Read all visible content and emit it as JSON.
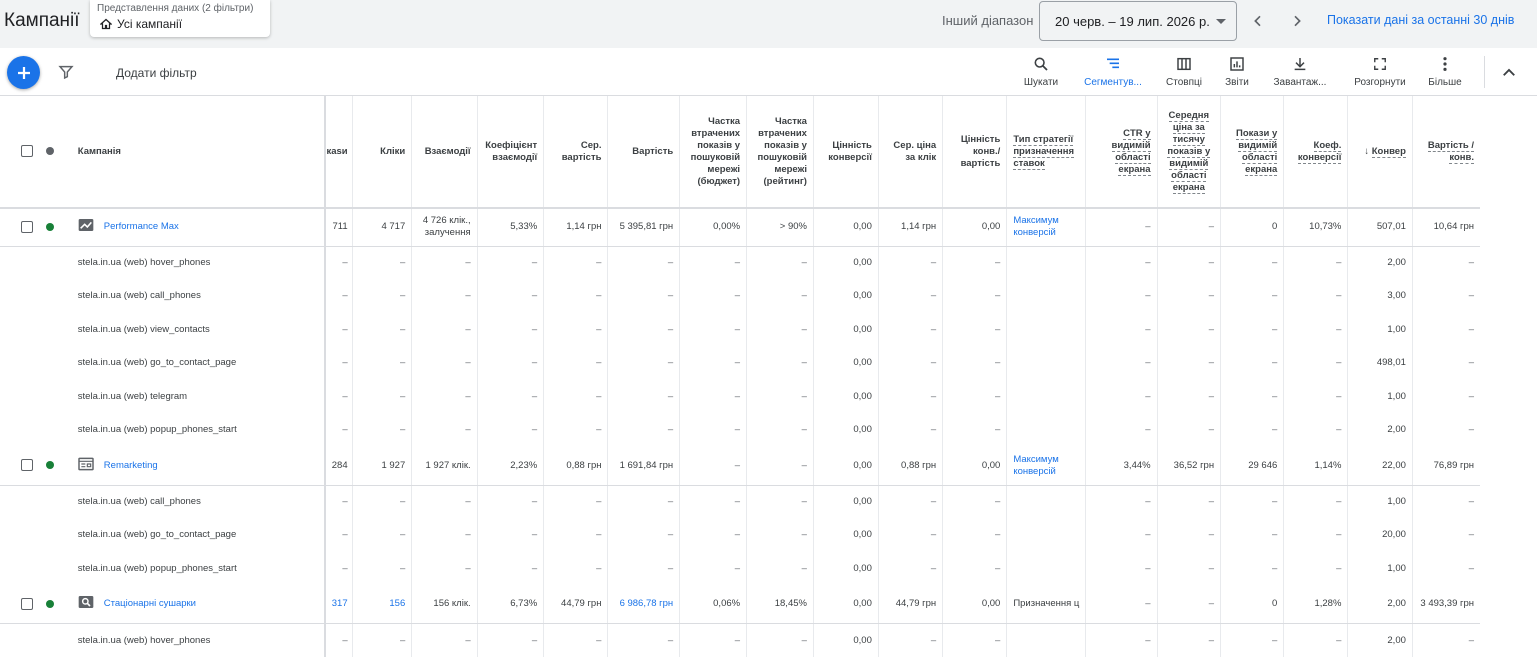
{
  "header": {
    "title": "Кампанії",
    "view_caption": "Представлення даних (2 фільтри)",
    "view_value": "Усі кампанії",
    "range_label": "Інший діапазон",
    "date_range": "20 черв. – 19 лип. 2026 р.",
    "compare_link": "Показати дані за останні 30 днів"
  },
  "toolbar": {
    "add_filter": "Додати фільтр",
    "search": "Шукати",
    "segment": "Сегментув...",
    "columns": "Стовпці",
    "reports": "Звіти",
    "download": "Завантаж...",
    "expand": "Розгорнути",
    "more": "Більше"
  },
  "colors": {
    "accent": "#1a73e8",
    "enabled_dot": "#188038",
    "header_bg": "#f1f3f4"
  },
  "table": {
    "headers": {
      "campaign": "Кампанія",
      "impressions": "каsи",
      "clicks": "Кліки",
      "interactions": "Взаємодії",
      "interaction_rate": "Коефіцієнт взаємодії",
      "avg_cost": "Сер. вартість",
      "cost": "Вартість",
      "lost_budget": "Частка втрачених показів у пошуковій мережі (бюджет)",
      "lost_rank": "Частка втрачених показів у пошуковій мережі (рейтинг)",
      "conv_value": "Цінність конверсії",
      "avg_cpc": "Сер. ціна за клік",
      "conv_value_cost": "Цінність конв./ вартість",
      "bid_strategy": "Тип стратегії призначення ставок",
      "viewable_ctr": "CTR у видимій області екрана",
      "avg_vcpm": "Середня ціна за тисячу показів у видимій області екрана",
      "viewable_impr": "Покази у видимій області екрана",
      "conv_rate": "Коеф. конверсії",
      "conversions": "Конвер",
      "cost_conv": "Вартість / конв."
    },
    "rows": [
      {
        "type": "campaign",
        "icon": "performance-max-icon",
        "name": "Performance Max",
        "impr": "711",
        "clicks": "4 717",
        "inter": "4 726 клік., залучення",
        "irate": "5,33%",
        "avgcost": "1,14 грн",
        "cost": "5 395,81 грн",
        "lbud": "0,00%",
        "lrank": "> 90%",
        "cval": "0,00",
        "cpc": "1,14 грн",
        "vcost": "0,00",
        "bid": "Максимум конверсій",
        "vctr": "–",
        "vcpm": "–",
        "vimpr": "0",
        "crate": "10,73%",
        "conv": "507,01",
        "cpconv": "10,64 грн"
      },
      {
        "type": "conversion",
        "name": "stela.in.ua (web) hover_phones",
        "cval": "0,00",
        "conv": "2,00"
      },
      {
        "type": "conversion",
        "name": "stela.in.ua (web) call_phones",
        "cval": "0,00",
        "conv": "3,00"
      },
      {
        "type": "conversion",
        "name": "stela.in.ua (web) view_contacts",
        "cval": "0,00",
        "conv": "1,00"
      },
      {
        "type": "conversion",
        "name": "stela.in.ua (web) go_to_contact_page",
        "cval": "0,00",
        "conv": "498,01"
      },
      {
        "type": "conversion",
        "name": "stela.in.ua (web) telegram",
        "cval": "0,00",
        "conv": "1,00"
      },
      {
        "type": "conversion",
        "name": "stela.in.ua (web) popup_phones_start",
        "cval": "0,00",
        "conv": "2,00"
      },
      {
        "type": "campaign",
        "icon": "display-icon",
        "name": "Remarketing",
        "impr": "284",
        "clicks": "1 927",
        "inter": "1 927 клік.",
        "irate": "2,23%",
        "avgcost": "0,88 грн",
        "cost": "1 691,84 грн",
        "lbud": "–",
        "lrank": "–",
        "cval": "0,00",
        "cpc": "0,88 грн",
        "vcost": "0,00",
        "bid": "Максимум конверсій",
        "vctr": "3,44%",
        "vcpm": "36,52 грн",
        "vimpr": "29 646",
        "crate": "1,14%",
        "conv": "22,00",
        "cpconv": "76,89 грн"
      },
      {
        "type": "conversion",
        "name": "stela.in.ua (web) call_phones",
        "cval": "0,00",
        "conv": "1,00"
      },
      {
        "type": "conversion",
        "name": "stela.in.ua (web) go_to_contact_page",
        "cval": "0,00",
        "conv": "20,00"
      },
      {
        "type": "conversion",
        "name": "stela.in.ua (web) popup_phones_start",
        "cval": "0,00",
        "conv": "1,00"
      },
      {
        "type": "campaign",
        "icon": "search-campaign-icon",
        "name": "Стаціонарні сушарки",
        "impr": "317",
        "clicks": "156",
        "inter": "156 клік.",
        "irate": "6,73%",
        "avgcost": "44,79 грн",
        "cost": "6 986,78 грн",
        "lbud": "0,06%",
        "lrank": "18,45%",
        "cval": "0,00",
        "cpc": "44,79 грн",
        "vcost": "0,00",
        "bid": "Призначення ц",
        "vctr": "–",
        "vcpm": "–",
        "vimpr": "0",
        "crate": "1,28%",
        "conv": "2,00",
        "cpconv": "3 493,39 грн"
      },
      {
        "type": "conversion",
        "name": "stela.in.ua (web) hover_phones",
        "cval": "0,00",
        "conv": "2,00"
      }
    ]
  }
}
